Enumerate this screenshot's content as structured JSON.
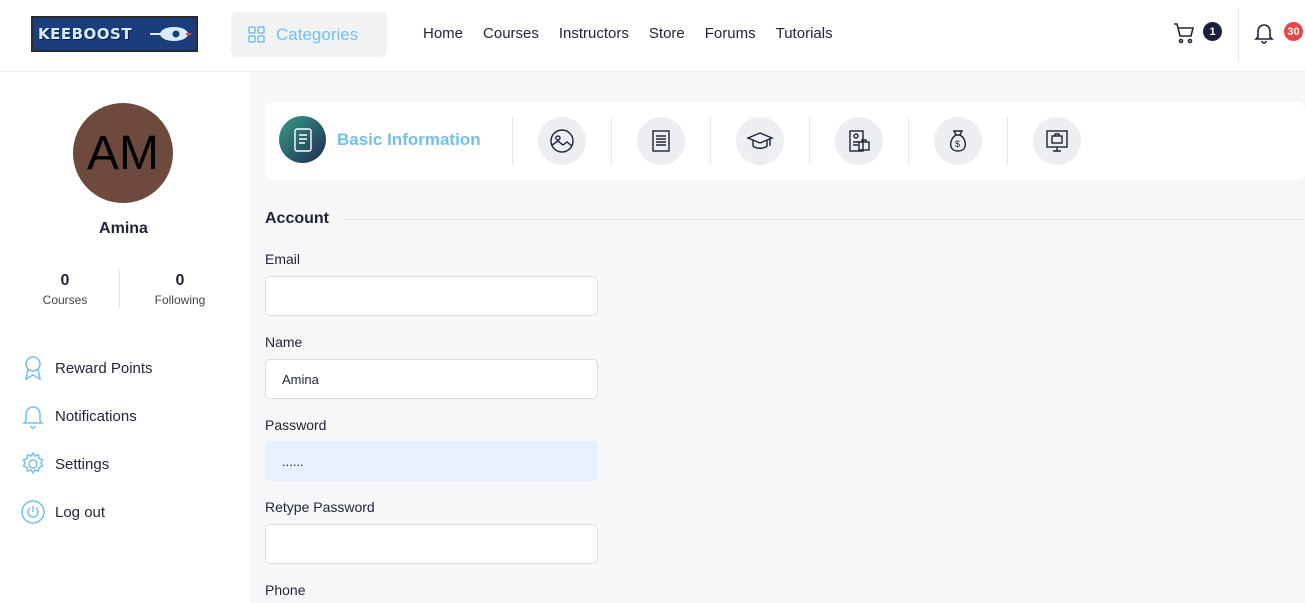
{
  "header": {
    "logo_text": "KEEBOOST",
    "categories_label": "Categories",
    "nav": [
      "Home",
      "Courses",
      "Instructors",
      "Store",
      "Forums",
      "Tutorials"
    ],
    "cart_count": "1",
    "notification_count": "30"
  },
  "profile": {
    "initials": "AM",
    "name": "Amina",
    "stats": [
      {
        "value": "0",
        "label": "Courses"
      },
      {
        "value": "0",
        "label": "Following"
      }
    ]
  },
  "sidebar_menu": [
    {
      "label": "Reward Points",
      "icon": "award-icon"
    },
    {
      "label": "Notifications",
      "icon": "bell-icon"
    },
    {
      "label": "Settings",
      "icon": "gear-icon"
    },
    {
      "label": "Log out",
      "icon": "power-icon"
    }
  ],
  "steps": {
    "active_label": "Basic Information",
    "icons": [
      "image-icon",
      "document-icon",
      "graduation-cap-icon",
      "id-card-briefcase-icon",
      "money-bag-icon",
      "monitor-briefcase-icon"
    ]
  },
  "form": {
    "section_title": "Account",
    "email_label": "Email",
    "email_value": "",
    "name_label": "Name",
    "name_value": "Amina",
    "password_label": "Password",
    "password_value": "......",
    "retype_label": "Retype Password",
    "retype_value": "",
    "phone_label": "Phone"
  },
  "colors": {
    "accent": "#74c0e8",
    "dark": "#1b1f3b",
    "badge_red": "#e84545",
    "avatar": "#6d4a3d"
  }
}
